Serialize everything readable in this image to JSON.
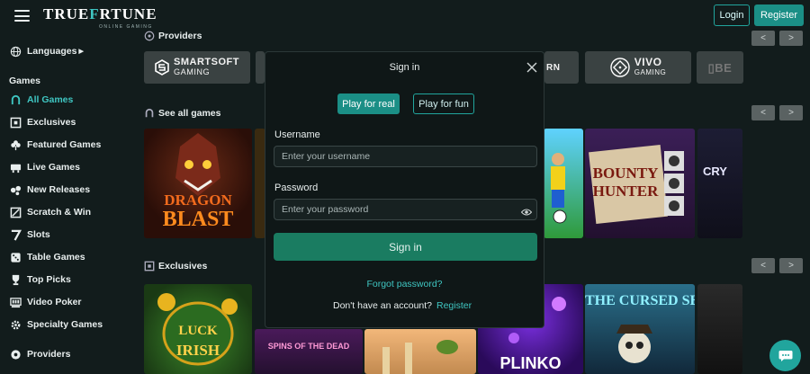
{
  "header": {
    "logo_main_a": "TRUE",
    "logo_main_b": "F",
    "logo_main_c": "RTUNE",
    "logo_sub": "ONLINE GAMING",
    "login_label": "Login",
    "register_label": "Register"
  },
  "sidebar": {
    "languages_label": "Languages",
    "games_heading": "Games",
    "items": [
      {
        "label": "All Games",
        "icon": "horseshoe-icon",
        "active": true
      },
      {
        "label": "Exclusives",
        "icon": "exclusive-badge-icon",
        "active": false
      },
      {
        "label": "Featured Games",
        "icon": "clover-icon",
        "active": false
      },
      {
        "label": "Live Games",
        "icon": "live-table-icon",
        "active": false
      },
      {
        "label": "New Releases",
        "icon": "new-tag-icon",
        "active": false
      },
      {
        "label": "Scratch & Win",
        "icon": "scratch-card-icon",
        "active": false
      },
      {
        "label": "Slots",
        "icon": "seven-icon",
        "active": false
      },
      {
        "label": "Table Games",
        "icon": "dice-icon",
        "active": false
      },
      {
        "label": "Top Picks",
        "icon": "trophy-icon",
        "active": false
      },
      {
        "label": "Video Poker",
        "icon": "poker-machine-icon",
        "active": false
      },
      {
        "label": "Specialty Games",
        "icon": "gear-icon",
        "active": false
      }
    ],
    "providers_label": "Providers"
  },
  "main": {
    "providers_title": "Providers",
    "see_all_title": "See all games",
    "exclusives_title": "Exclusives",
    "providers": [
      {
        "name": "SMARTSOFT",
        "sub": "GAMING"
      },
      {
        "name": "VIVO",
        "sub": "GAMING"
      }
    ],
    "games_row1": [
      "DRAGON",
      "BLAST",
      "BOUNTY",
      "HUNTER"
    ],
    "games_row2": [
      "LUCK",
      "IRISH",
      "SPINS OF THE DEAD",
      "PLINKO",
      "THE CURSED SEA"
    ]
  },
  "modal": {
    "title": "Sign in",
    "tab_real": "Play for real",
    "tab_fun": "Play for fun",
    "username_label": "Username",
    "username_placeholder": "Enter your username",
    "password_label": "Password",
    "password_placeholder": "Enter your password",
    "signin_label": "Sign in",
    "forgot_label": "Forgot password?",
    "no_account_label": "Don't have an account?",
    "register_link": "Register"
  },
  "colors": {
    "accent": "#3fc6c2",
    "primary_button": "#1b8f86",
    "signin_button": "#1a7c61",
    "background": "#121c1c"
  }
}
